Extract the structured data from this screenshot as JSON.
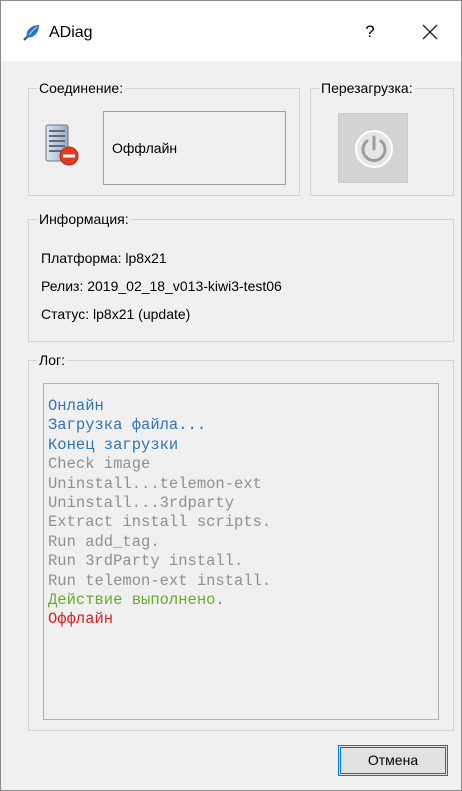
{
  "window": {
    "title": "ADiag",
    "help_label": "?"
  },
  "connection": {
    "label": "Соединение:",
    "status": "Оффлайн"
  },
  "reboot": {
    "label": "Перезагрузка:"
  },
  "info": {
    "label": "Информация:",
    "platform": "Платформа: lp8x21",
    "release": "Релиз: 2019_02_18_v013-kiwi3-test06",
    "status": "Статус: lp8x21 (update)"
  },
  "log": {
    "label": "Лог:",
    "lines": [
      {
        "text": "Онлайн",
        "color": "#2e75b6"
      },
      {
        "text": "Загрузка файла...",
        "color": "#2e75b6"
      },
      {
        "text": "Конец загрузки",
        "color": "#2e75b6"
      },
      {
        "text": "Check image",
        "color": "#909090"
      },
      {
        "text": "Uninstall...telemon-ext",
        "color": "#909090"
      },
      {
        "text": "Uninstall...3rdparty",
        "color": "#909090"
      },
      {
        "text": "Extract install scripts.",
        "color": "#909090"
      },
      {
        "text": "Run add_tag.",
        "color": "#909090"
      },
      {
        "text": "Run 3rdParty install.",
        "color": "#909090"
      },
      {
        "text": "Run telemon-ext install.",
        "color": "#909090"
      },
      {
        "text": "Действие выполнено.",
        "color": "#6aaa2a"
      },
      {
        "text": "Оффлайн",
        "color": "#e02020"
      }
    ]
  },
  "buttons": {
    "cancel_label": "Отмена"
  },
  "icons": {
    "app": "app-feather-icon",
    "close": "close-icon",
    "server": "server-offline-icon",
    "power": "power-icon"
  }
}
